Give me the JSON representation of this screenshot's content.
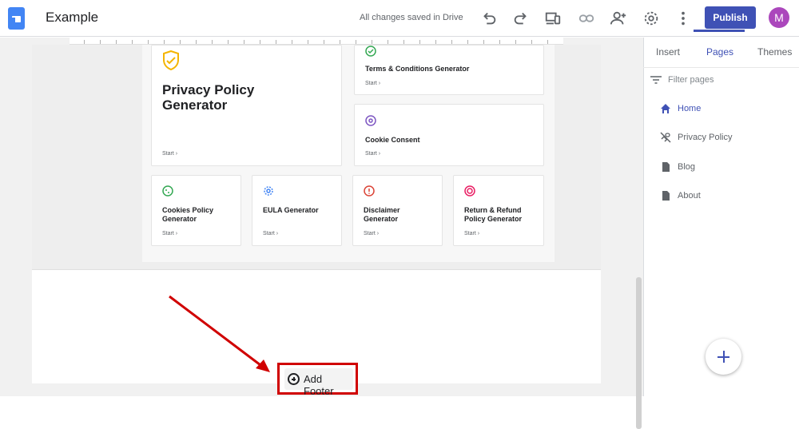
{
  "header": {
    "title": "Example",
    "save_status": "All changes saved in Drive",
    "publish_label": "Publish",
    "avatar_initial": "M",
    "icons": [
      "undo-icon",
      "redo-icon",
      "preview-devices-icon",
      "link-icon",
      "share-icon",
      "settings-icon",
      "more-vert-icon"
    ]
  },
  "editor": {
    "cards": {
      "privacy": {
        "title": "Privacy Policy Generator",
        "start": "Start ›"
      },
      "terms": {
        "title": "Terms & Conditions Generator",
        "start": "Start ›"
      },
      "cookie_consent": {
        "title": "Cookie Consent",
        "start": "Start ›"
      },
      "cookies_policy": {
        "title": "Cookies Policy Generator",
        "start": "Start ›"
      },
      "eula": {
        "title": "EULA Generator",
        "start": "Start ›"
      },
      "disclaimer": {
        "title": "Disclaimer Generator",
        "start": "Start ›"
      },
      "return_refund": {
        "title": "Return & Refund Policy Generator",
        "start": "Start ›"
      }
    },
    "add_footer_label": "Add Footer"
  },
  "sidebar": {
    "tabs": [
      {
        "label": "Insert",
        "active": false
      },
      {
        "label": "Pages",
        "active": true
      },
      {
        "label": "Themes",
        "active": false
      }
    ],
    "filter_placeholder": "Filter pages",
    "pages": [
      {
        "label": "Home",
        "icon": "home-icon",
        "active": true
      },
      {
        "label": "Privacy Policy",
        "icon": "hidden-link-icon",
        "active": false
      },
      {
        "label": "Blog",
        "icon": "page-icon",
        "active": false
      },
      {
        "label": "About",
        "icon": "page-icon",
        "active": false
      }
    ],
    "add_page_icon": "plus-icon"
  },
  "colors": {
    "accent": "#3f51b5",
    "avatar": "#ab47bc",
    "annotation": "#d00000"
  }
}
